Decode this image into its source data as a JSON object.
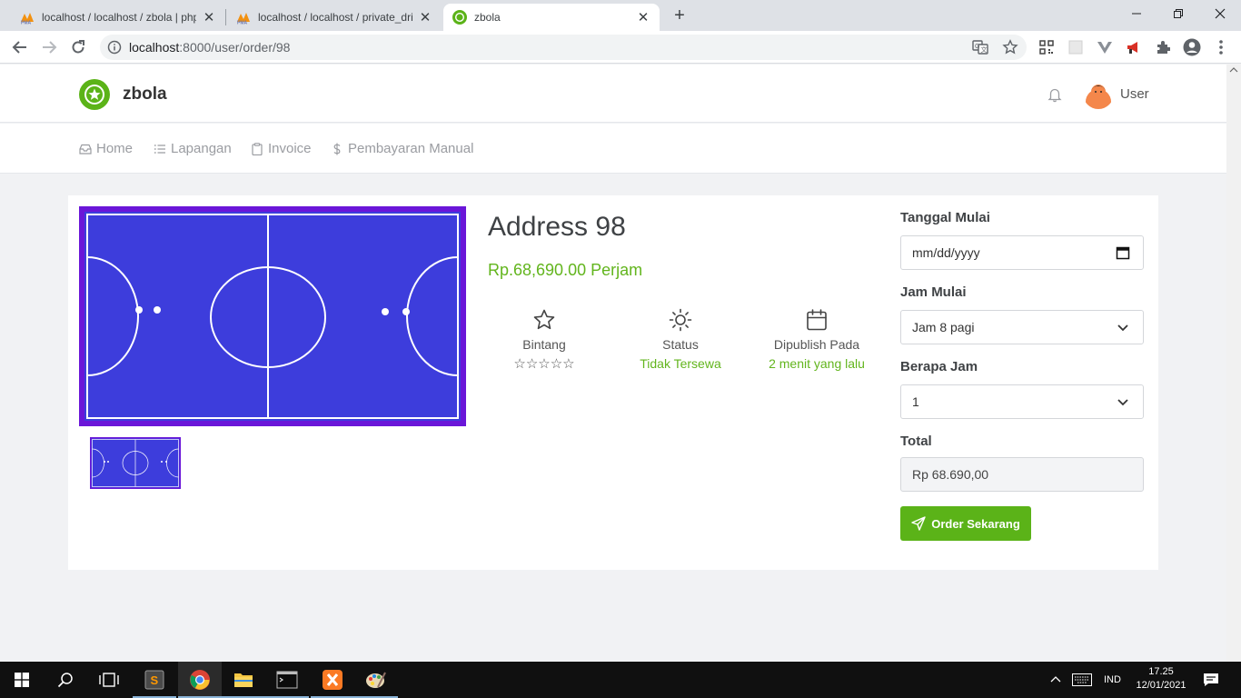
{
  "browser": {
    "tabs": [
      {
        "title": "localhost / localhost / zbola | php",
        "active": false
      },
      {
        "title": "localhost / localhost / private_dri",
        "active": false
      },
      {
        "title": "zbola",
        "active": true
      }
    ],
    "new_tab": "+",
    "url_host": "localhost",
    "url_path": ":8000/user/order/98"
  },
  "header": {
    "brand": "zbola",
    "user": "User"
  },
  "menu": [
    {
      "label": "Home",
      "icon": "inbox-icon"
    },
    {
      "label": "Lapangan",
      "icon": "list-icon"
    },
    {
      "label": "Invoice",
      "icon": "clipboard-icon"
    },
    {
      "label": "Pembayaran Manual",
      "icon": "dollar-icon"
    }
  ],
  "product": {
    "title": "Address 98",
    "price": "Rp.68,690.00 Perjam",
    "stats": [
      {
        "label": "Bintang",
        "stars": "☆☆☆☆☆",
        "icon": "star-icon"
      },
      {
        "label": "Status",
        "value": "Tidak Tersewa",
        "icon": "sun-icon"
      },
      {
        "label": "Dipublish Pada",
        "value": "2 menit yang lalu",
        "icon": "calendar-icon"
      }
    ]
  },
  "form": {
    "date_label": "Tanggal Mulai",
    "date_placeholder": "mm/dd/yyyy",
    "start_label": "Jam Mulai",
    "start_value": "Jam 8 pagi",
    "hours_label": "Berapa Jam",
    "hours_value": "1",
    "total_label": "Total",
    "total_value": "Rp 68.690,00",
    "order_button": "Order Sekarang"
  },
  "taskbar": {
    "language": "IND",
    "time": "17.25",
    "date": "12/01/2021"
  },
  "colors": {
    "accent_green": "#5bb318",
    "court_blue": "#3d3ddc",
    "court_border": "#6a16d8"
  }
}
